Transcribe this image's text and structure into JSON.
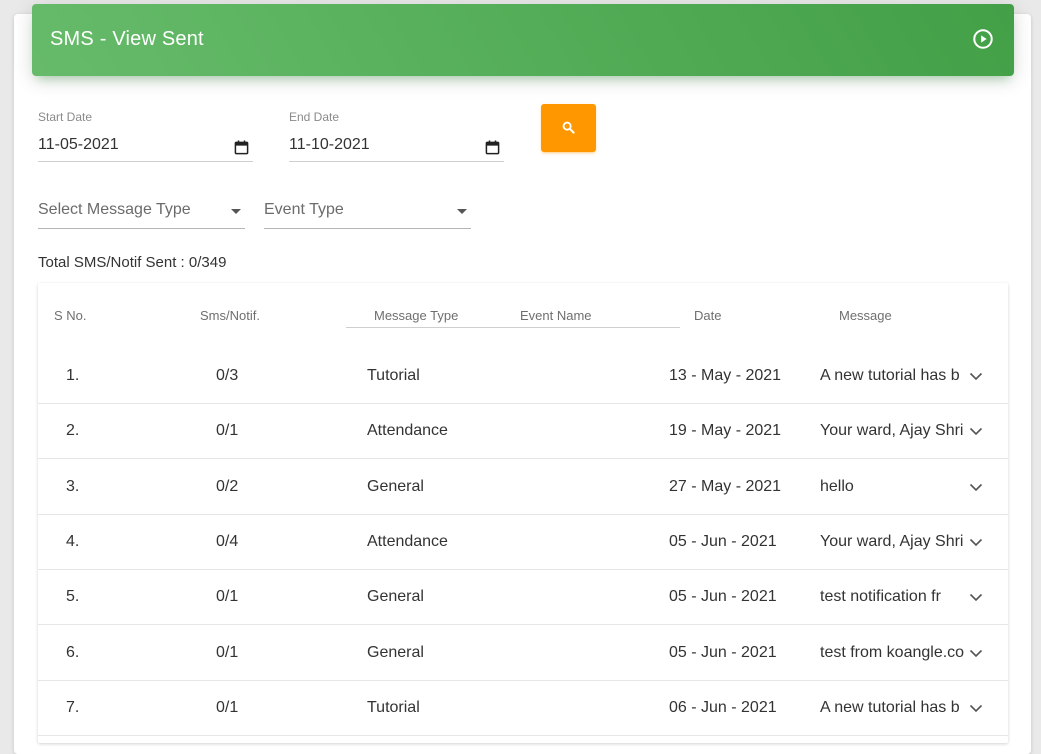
{
  "header": {
    "title": "SMS - View Sent",
    "play_icon": "play-circle-icon"
  },
  "filters": {
    "start_date": {
      "label": "Start Date",
      "value": "11-05-2021"
    },
    "end_date": {
      "label": "End Date",
      "value": "11-10-2021"
    },
    "search_icon": "search-icon",
    "message_type": {
      "value": "Select Message Type"
    },
    "event_type": {
      "value": "Event Type"
    }
  },
  "summary": {
    "total_text": "Total SMS/Notif Sent : 0/349"
  },
  "table": {
    "columns": [
      "S No.",
      "Sms/Notif.",
      "Message Type",
      "Event Name",
      "Date",
      "Message"
    ],
    "rows": [
      {
        "sno": "1.",
        "count": "0/3",
        "type": "Tutorial",
        "event": "",
        "date": "13 - May - 2021",
        "message": "A new tutorial has b"
      },
      {
        "sno": "2.",
        "count": "0/1",
        "type": "Attendance",
        "event": "",
        "date": "19 - May - 2021",
        "message": "Your ward, Ajay Shri"
      },
      {
        "sno": "3.",
        "count": "0/2",
        "type": "General",
        "event": "",
        "date": "27 - May - 2021",
        "message": "hello"
      },
      {
        "sno": "4.",
        "count": "0/4",
        "type": "Attendance",
        "event": "",
        "date": "05 - Jun - 2021",
        "message": "Your ward, Ajay Shri"
      },
      {
        "sno": "5.",
        "count": "0/1",
        "type": "General",
        "event": "",
        "date": "05 - Jun - 2021",
        "message": "test notification fr"
      },
      {
        "sno": "6.",
        "count": "0/1",
        "type": "General",
        "event": "",
        "date": "05 - Jun - 2021",
        "message": "test from koangle.co"
      },
      {
        "sno": "7.",
        "count": "0/1",
        "type": "Tutorial",
        "event": "",
        "date": "06 - Jun - 2021",
        "message": "A new tutorial has b"
      }
    ]
  },
  "colors": {
    "header_green": "#4caf50",
    "search_orange": "#ff9800"
  }
}
